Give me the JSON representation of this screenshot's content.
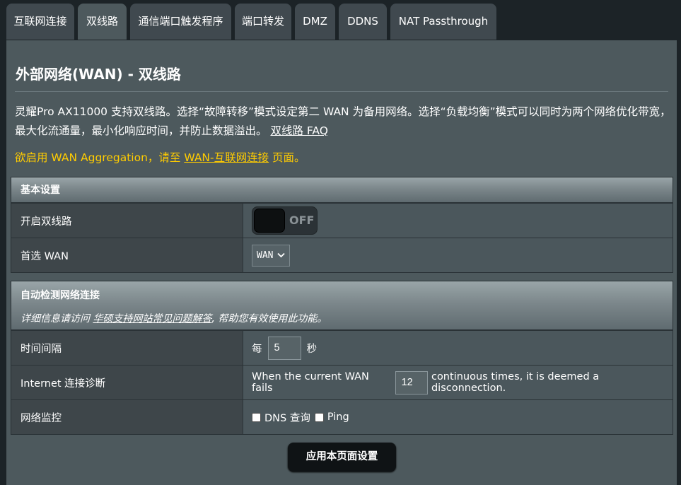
{
  "tabs": [
    {
      "label": "互联网连接",
      "active": false
    },
    {
      "label": "双线路",
      "active": true
    },
    {
      "label": "通信端口触发程序",
      "active": false
    },
    {
      "label": "端口转发",
      "active": false
    },
    {
      "label": "DMZ",
      "active": false
    },
    {
      "label": "DDNS",
      "active": false
    },
    {
      "label": "NAT Passthrough",
      "active": false
    }
  ],
  "page": {
    "title": "外部网络(WAN) - 双线路",
    "description": "灵耀Pro AX11000 支持双线路。选择“故障转移”模式设定第二 WAN 为备用网络。选择“负载均衡”模式可以同时为两个网络优化带宽，最大化流通量，最小化响应时间，并防止数据溢出。",
    "faq_link": "双线路 FAQ",
    "notice_prefix": "欲启用 WAN Aggregation，请至 ",
    "notice_link": "WAN-互联网连接",
    "notice_suffix": " 页面。"
  },
  "basic": {
    "header": "基本设置",
    "dual_wan_label": "开启双线路",
    "dual_wan_state": "OFF",
    "primary_wan_label": "首选 WAN",
    "primary_wan_value": "WAN"
  },
  "detect": {
    "header": "自动检测网络连接",
    "note_prefix": "详细信息请访问 ",
    "note_link": "华硕支持网站常见问题解答",
    "note_suffix": ", 帮助您有效使用此功能。",
    "interval_label": "时间间隔",
    "interval_prefix": "每",
    "interval_value": "5",
    "interval_suffix": "秒",
    "diag_label": "Internet 连接诊断",
    "diag_prefix": "When the current WAN fails",
    "diag_value": "12",
    "diag_suffix": "continuous times, it is deemed a disconnection.",
    "monitor_label": "网络监控",
    "monitor_dns": "DNS 查询",
    "monitor_ping": "Ping"
  },
  "apply_button": "应用本页面设置",
  "colors": {
    "background": "#1c2327",
    "panel": "#4d595d",
    "notice": "#ffcc00"
  }
}
